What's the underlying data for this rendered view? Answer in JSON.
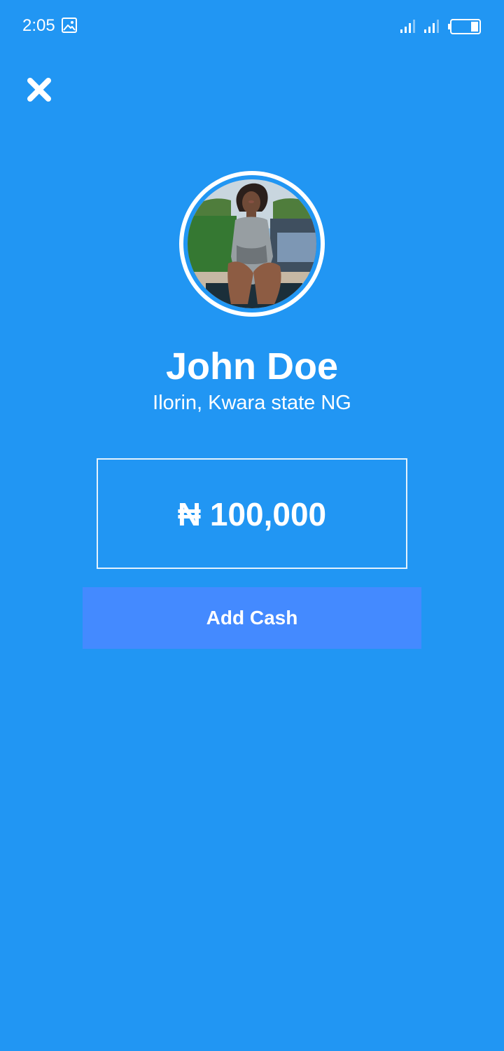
{
  "status_bar": {
    "time": "2:05",
    "icons": [
      "gallery-icon",
      "signal-icon",
      "signal-icon",
      "battery-icon"
    ]
  },
  "header": {
    "close_icon": "close-icon"
  },
  "profile": {
    "avatar": "profile-photo",
    "name": "John Doe",
    "location": "Ilorin, Kwara state NG"
  },
  "balance": {
    "display": "₦ 100,000"
  },
  "actions": {
    "add_cash_label": "Add Cash"
  },
  "colors": {
    "background": "#2196F3",
    "button": "#448AFF",
    "text": "#FFFFFF"
  }
}
